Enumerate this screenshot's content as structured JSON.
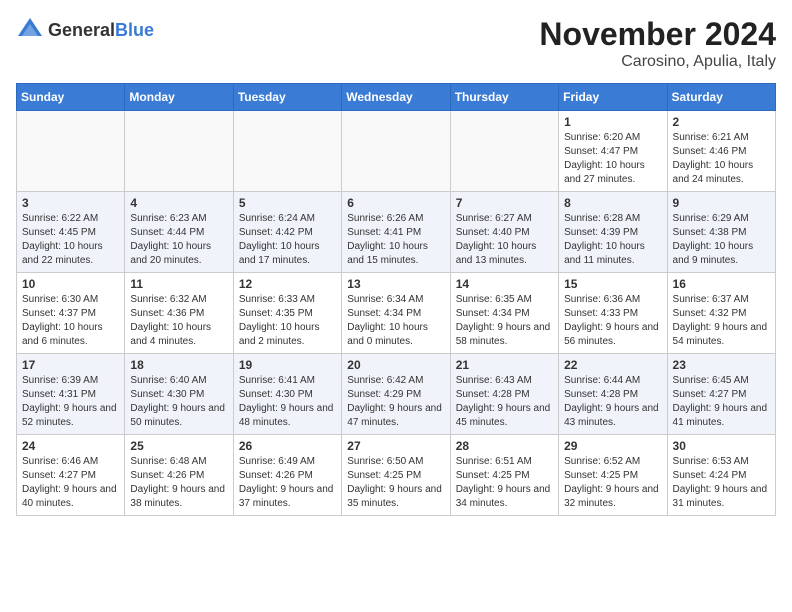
{
  "header": {
    "logo_general": "General",
    "logo_blue": "Blue",
    "month_title": "November 2024",
    "location": "Carosino, Apulia, Italy"
  },
  "days_of_week": [
    "Sunday",
    "Monday",
    "Tuesday",
    "Wednesday",
    "Thursday",
    "Friday",
    "Saturday"
  ],
  "weeks": [
    [
      {
        "day": "",
        "info": ""
      },
      {
        "day": "",
        "info": ""
      },
      {
        "day": "",
        "info": ""
      },
      {
        "day": "",
        "info": ""
      },
      {
        "day": "",
        "info": ""
      },
      {
        "day": "1",
        "info": "Sunrise: 6:20 AM\nSunset: 4:47 PM\nDaylight: 10 hours and 27 minutes."
      },
      {
        "day": "2",
        "info": "Sunrise: 6:21 AM\nSunset: 4:46 PM\nDaylight: 10 hours and 24 minutes."
      }
    ],
    [
      {
        "day": "3",
        "info": "Sunrise: 6:22 AM\nSunset: 4:45 PM\nDaylight: 10 hours and 22 minutes."
      },
      {
        "day": "4",
        "info": "Sunrise: 6:23 AM\nSunset: 4:44 PM\nDaylight: 10 hours and 20 minutes."
      },
      {
        "day": "5",
        "info": "Sunrise: 6:24 AM\nSunset: 4:42 PM\nDaylight: 10 hours and 17 minutes."
      },
      {
        "day": "6",
        "info": "Sunrise: 6:26 AM\nSunset: 4:41 PM\nDaylight: 10 hours and 15 minutes."
      },
      {
        "day": "7",
        "info": "Sunrise: 6:27 AM\nSunset: 4:40 PM\nDaylight: 10 hours and 13 minutes."
      },
      {
        "day": "8",
        "info": "Sunrise: 6:28 AM\nSunset: 4:39 PM\nDaylight: 10 hours and 11 minutes."
      },
      {
        "day": "9",
        "info": "Sunrise: 6:29 AM\nSunset: 4:38 PM\nDaylight: 10 hours and 9 minutes."
      }
    ],
    [
      {
        "day": "10",
        "info": "Sunrise: 6:30 AM\nSunset: 4:37 PM\nDaylight: 10 hours and 6 minutes."
      },
      {
        "day": "11",
        "info": "Sunrise: 6:32 AM\nSunset: 4:36 PM\nDaylight: 10 hours and 4 minutes."
      },
      {
        "day": "12",
        "info": "Sunrise: 6:33 AM\nSunset: 4:35 PM\nDaylight: 10 hours and 2 minutes."
      },
      {
        "day": "13",
        "info": "Sunrise: 6:34 AM\nSunset: 4:34 PM\nDaylight: 10 hours and 0 minutes."
      },
      {
        "day": "14",
        "info": "Sunrise: 6:35 AM\nSunset: 4:34 PM\nDaylight: 9 hours and 58 minutes."
      },
      {
        "day": "15",
        "info": "Sunrise: 6:36 AM\nSunset: 4:33 PM\nDaylight: 9 hours and 56 minutes."
      },
      {
        "day": "16",
        "info": "Sunrise: 6:37 AM\nSunset: 4:32 PM\nDaylight: 9 hours and 54 minutes."
      }
    ],
    [
      {
        "day": "17",
        "info": "Sunrise: 6:39 AM\nSunset: 4:31 PM\nDaylight: 9 hours and 52 minutes."
      },
      {
        "day": "18",
        "info": "Sunrise: 6:40 AM\nSunset: 4:30 PM\nDaylight: 9 hours and 50 minutes."
      },
      {
        "day": "19",
        "info": "Sunrise: 6:41 AM\nSunset: 4:30 PM\nDaylight: 9 hours and 48 minutes."
      },
      {
        "day": "20",
        "info": "Sunrise: 6:42 AM\nSunset: 4:29 PM\nDaylight: 9 hours and 47 minutes."
      },
      {
        "day": "21",
        "info": "Sunrise: 6:43 AM\nSunset: 4:28 PM\nDaylight: 9 hours and 45 minutes."
      },
      {
        "day": "22",
        "info": "Sunrise: 6:44 AM\nSunset: 4:28 PM\nDaylight: 9 hours and 43 minutes."
      },
      {
        "day": "23",
        "info": "Sunrise: 6:45 AM\nSunset: 4:27 PM\nDaylight: 9 hours and 41 minutes."
      }
    ],
    [
      {
        "day": "24",
        "info": "Sunrise: 6:46 AM\nSunset: 4:27 PM\nDaylight: 9 hours and 40 minutes."
      },
      {
        "day": "25",
        "info": "Sunrise: 6:48 AM\nSunset: 4:26 PM\nDaylight: 9 hours and 38 minutes."
      },
      {
        "day": "26",
        "info": "Sunrise: 6:49 AM\nSunset: 4:26 PM\nDaylight: 9 hours and 37 minutes."
      },
      {
        "day": "27",
        "info": "Sunrise: 6:50 AM\nSunset: 4:25 PM\nDaylight: 9 hours and 35 minutes."
      },
      {
        "day": "28",
        "info": "Sunrise: 6:51 AM\nSunset: 4:25 PM\nDaylight: 9 hours and 34 minutes."
      },
      {
        "day": "29",
        "info": "Sunrise: 6:52 AM\nSunset: 4:25 PM\nDaylight: 9 hours and 32 minutes."
      },
      {
        "day": "30",
        "info": "Sunrise: 6:53 AM\nSunset: 4:24 PM\nDaylight: 9 hours and 31 minutes."
      }
    ]
  ]
}
